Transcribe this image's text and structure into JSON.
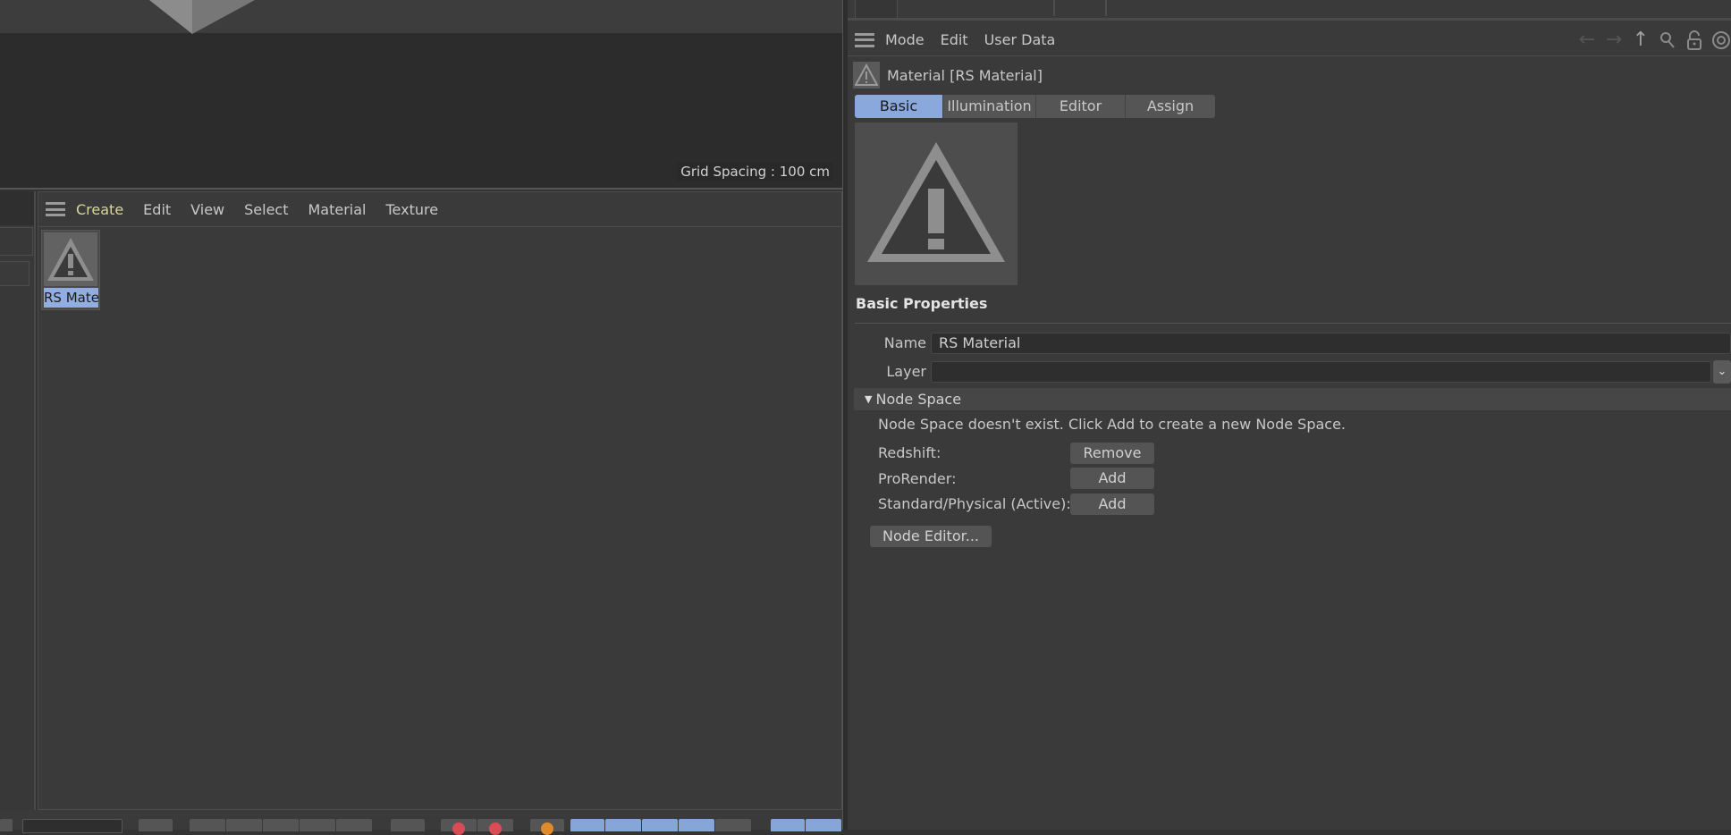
{
  "viewport": {
    "grid_spacing_label": "Grid Spacing : 100 cm"
  },
  "material_manager": {
    "menu": [
      {
        "label": "Create",
        "active": true
      },
      {
        "label": "Edit"
      },
      {
        "label": "View"
      },
      {
        "label": "Select"
      },
      {
        "label": "Material"
      },
      {
        "label": "Texture"
      }
    ],
    "materials": [
      {
        "label": "RS Mate",
        "icon": "warning-icon",
        "selected": true
      }
    ]
  },
  "attribute_manager": {
    "menu": [
      {
        "label": "Mode"
      },
      {
        "label": "Edit"
      },
      {
        "label": "User Data"
      }
    ],
    "nav_icons": [
      "arrow-left-icon",
      "arrow-right-icon",
      "arrow-up-icon",
      "search-icon",
      "lock-icon",
      "target-icon"
    ],
    "title": "Material [RS Material]",
    "tabs": [
      {
        "label": "Basic",
        "active": true
      },
      {
        "label": "Illumination"
      },
      {
        "label": "Editor"
      },
      {
        "label": "Assign"
      }
    ],
    "section_title": "Basic Properties",
    "fields": {
      "name_label": "Name",
      "name_value": "RS Material",
      "layer_label": "Layer",
      "layer_value": ""
    },
    "node_space": {
      "header": "Node Space",
      "message": "Node Space doesn't exist. Click Add to create a new Node Space.",
      "rows": [
        {
          "label": "Redshift:",
          "button": "Remove"
        },
        {
          "label": "ProRender:",
          "button": "Add"
        },
        {
          "label": "Standard/Physical (Active):",
          "button": "Add"
        }
      ],
      "node_editor_button": "Node Editor..."
    }
  },
  "colors": {
    "accent_blue": "#8aa8db",
    "active_menu": "#d8d59a",
    "panel_bg": "#3a3a3a",
    "toolbar_orange": "#e08a2c",
    "toolbar_red": "#d94b55"
  }
}
